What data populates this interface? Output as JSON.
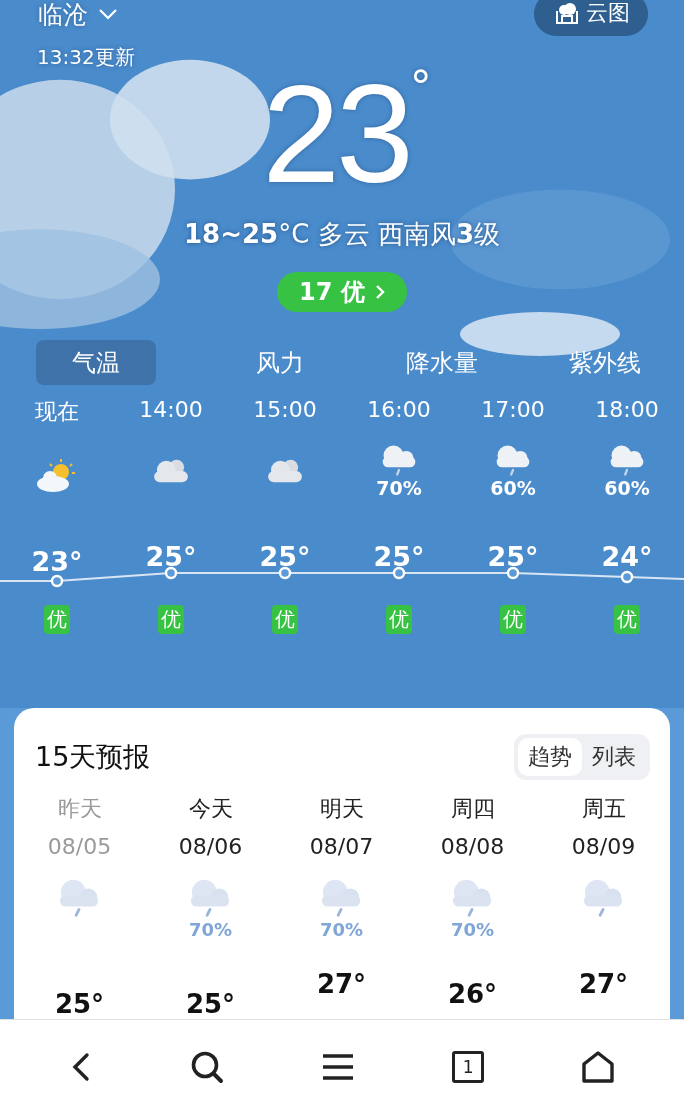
{
  "header": {
    "city": "临沧",
    "map_button": "云图",
    "updated": "13:32更新"
  },
  "current": {
    "temperature": "23",
    "degree": "°",
    "summary": "**18~25**°C 多云 西南风**3**级",
    "aqi": "17 优"
  },
  "tabs": [
    {
      "label": "气温",
      "selected": true
    },
    {
      "label": "风力",
      "selected": false
    },
    {
      "label": "降水量",
      "selected": false
    },
    {
      "label": "紫外线",
      "selected": false
    }
  ],
  "hourly": [
    {
      "time": "现在",
      "kind": "partly-sunny",
      "temp": "23°",
      "aqi": "优"
    },
    {
      "time": "14:00",
      "kind": "cloudy",
      "temp": "25°",
      "aqi": "优"
    },
    {
      "time": "15:00",
      "kind": "cloudy",
      "temp": "25°",
      "aqi": "优"
    },
    {
      "time": "16:00",
      "kind": "rain",
      "precip": "70%",
      "temp": "25°",
      "aqi": "优"
    },
    {
      "time": "17:00",
      "kind": "rain",
      "precip": "60%",
      "temp": "25°",
      "aqi": "优"
    },
    {
      "time": "18:00",
      "kind": "rain",
      "precip": "60%",
      "temp": "24°",
      "aqi": "优"
    }
  ],
  "forecast": {
    "title": "15天预报",
    "views": [
      {
        "label": "趋势",
        "selected": true
      },
      {
        "label": "列表",
        "selected": false
      }
    ],
    "days": [
      {
        "day": "昨天",
        "date": "08/05",
        "past": true,
        "kind": "rain",
        "high": "25°"
      },
      {
        "day": "今天",
        "date": "08/06",
        "past": false,
        "kind": "rain",
        "precip": "70%",
        "high": "25°"
      },
      {
        "day": "明天",
        "date": "08/07",
        "past": false,
        "kind": "rain",
        "precip": "70%",
        "high": "27°"
      },
      {
        "day": "周四",
        "date": "08/08",
        "past": false,
        "kind": "rain",
        "precip": "70%",
        "high": "26°"
      },
      {
        "day": "周五",
        "date": "08/09",
        "past": false,
        "kind": "rain",
        "high": "27°"
      }
    ]
  },
  "nav": {
    "tab_count": "1"
  }
}
